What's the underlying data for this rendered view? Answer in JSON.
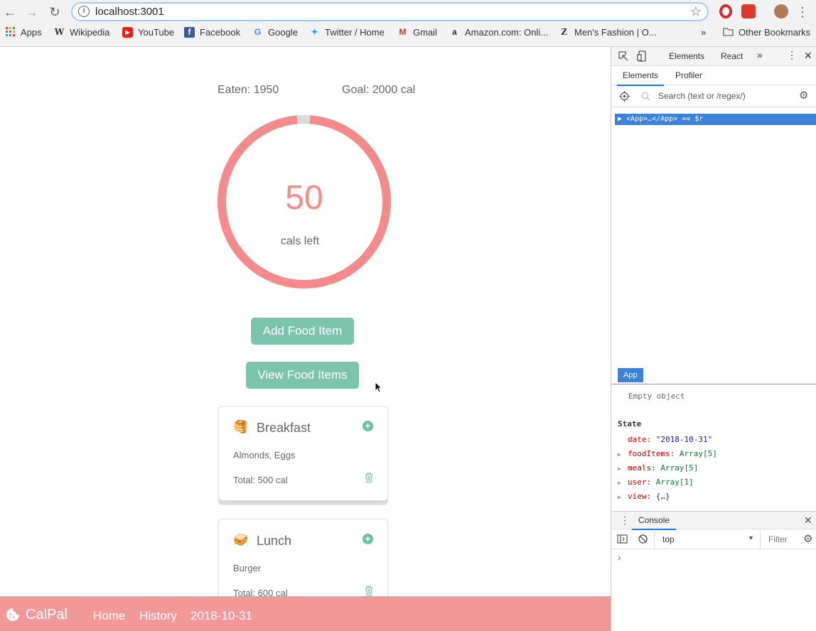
{
  "browser": {
    "url": "localhost:3001",
    "bookmarks": [
      "Apps",
      "Wikipedia",
      "YouTube",
      "Facebook",
      "Google",
      "Twitter / Home",
      "Gmail",
      "Amazon.com: Onli...",
      "Men's Fashion | O..."
    ],
    "overflow": "»",
    "other_bookmarks": "Other Bookmarks"
  },
  "app": {
    "eaten_label": "Eaten: 1950",
    "goal_label": "Goal: 2000 cal",
    "cals_left_value": "50",
    "cals_left_label": "cals left",
    "progress_fraction": 0.975,
    "add_button": "Add Food Item",
    "view_button": "View Food Items",
    "meals": [
      {
        "title": "Breakfast",
        "emoji": "🥞",
        "items": "Almonds, Eggs",
        "total": "Total: 500 cal"
      },
      {
        "title": "Lunch",
        "emoji": "🥪",
        "items": "Burger",
        "total": "Total: 600 cal"
      }
    ],
    "colors": {
      "accent": "#f48a8a",
      "green": "#7dc4ac",
      "footer": "#f29898"
    }
  },
  "footer": {
    "brand": "CalPal",
    "links": [
      "Home",
      "History",
      "2018-10-31"
    ]
  },
  "devtools": {
    "top_tabs": [
      "Elements",
      "React"
    ],
    "sub_tabs": [
      "Elements",
      "Profiler"
    ],
    "search_placeholder": "Search (text or /regex/)",
    "tree_row": "▶ <App>…</App> == $r",
    "selected_tag": "App",
    "props_text": "Empty object",
    "state_header": "State",
    "state": [
      {
        "key": "date:",
        "value": "\"2018-10-31\""
      },
      {
        "key": "foodItems:",
        "value": "Array[5]"
      },
      {
        "key": "meals:",
        "value": "Array[5]"
      },
      {
        "key": "user:",
        "value": "Array[1]"
      },
      {
        "key": "view:",
        "value": "{…}"
      }
    ],
    "console_tab": "Console",
    "console_context": "top",
    "console_filter": "Filter",
    "prompt": "›"
  }
}
